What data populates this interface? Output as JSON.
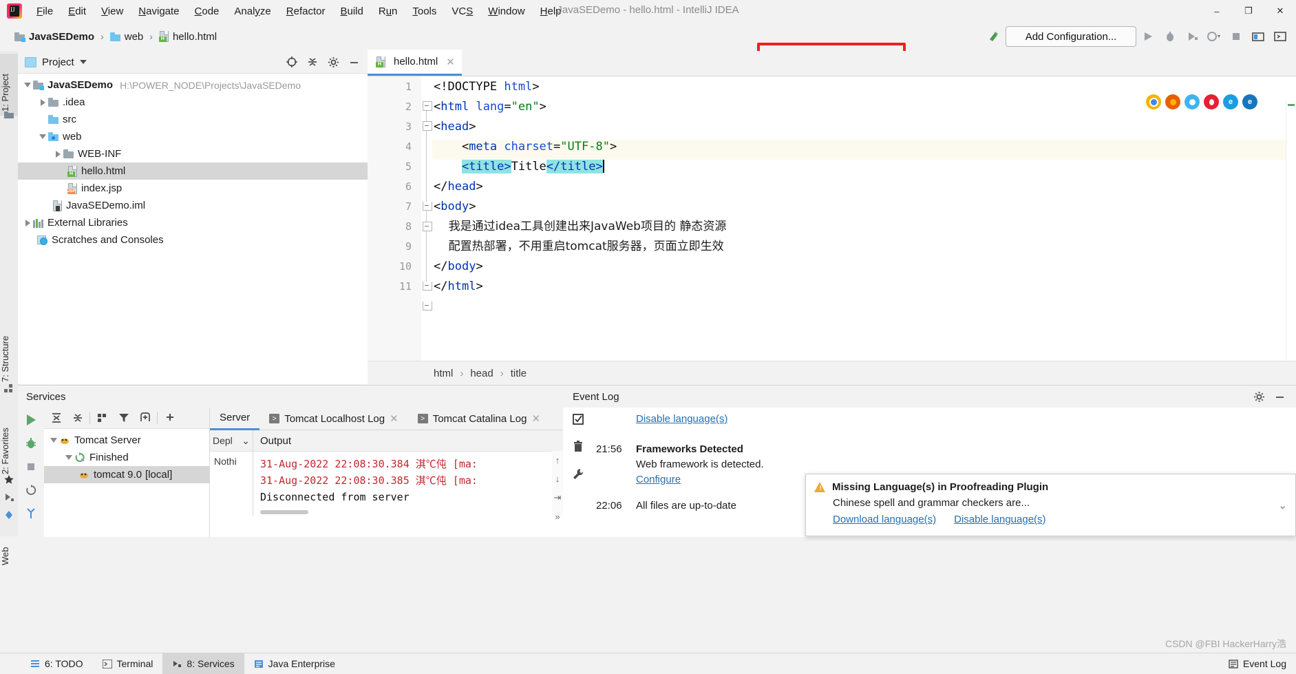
{
  "window": {
    "title": "JavaSEDemo - hello.html - IntelliJ IDEA",
    "minimize": "–",
    "maximize": "❐",
    "close": "✕"
  },
  "menubar": {
    "items": [
      {
        "label": "File",
        "mnemonic": "F"
      },
      {
        "label": "Edit",
        "mnemonic": "E"
      },
      {
        "label": "View",
        "mnemonic": "V"
      },
      {
        "label": "Navigate",
        "mnemonic": "N"
      },
      {
        "label": "Code",
        "mnemonic": "C"
      },
      {
        "label": "Analyze",
        "mnemonic": "y"
      },
      {
        "label": "Refactor",
        "mnemonic": "R"
      },
      {
        "label": "Build",
        "mnemonic": "B"
      },
      {
        "label": "Run",
        "mnemonic": "u"
      },
      {
        "label": "Tools",
        "mnemonic": "T"
      },
      {
        "label": "VCS",
        "mnemonic": "S"
      },
      {
        "label": "Window",
        "mnemonic": "W"
      },
      {
        "label": "Help",
        "mnemonic": "H"
      }
    ]
  },
  "navbar": {
    "breadcrumbs": [
      {
        "label": "JavaSEDemo",
        "icon": "module-icon"
      },
      {
        "label": "web",
        "icon": "folder-icon"
      },
      {
        "label": "hello.html",
        "icon": "html-file-icon"
      }
    ],
    "separator": "›",
    "add_configuration_label": "Add Configuration...",
    "highlight_color": "#f21f1f",
    "toolbar_icons": [
      "build-icon",
      "run-icon",
      "debug-icon",
      "run-coverage-icon",
      "profiler-icon",
      "stop-icon",
      "settings-sync-icon",
      "search-everywhere-icon"
    ]
  },
  "left_rail": {
    "top": [
      {
        "label": "1: Project",
        "selected": true
      }
    ],
    "bottom": [
      {
        "label": "7: Structure"
      },
      {
        "label": "2: Favorites"
      },
      {
        "label": "Web"
      }
    ]
  },
  "project_panel": {
    "title": "Project",
    "icons": [
      "locate-icon",
      "collapse-all-icon",
      "gear-icon",
      "hide-icon"
    ],
    "tree": [
      {
        "label": "JavaSEDemo",
        "path": "H:\\POWER_NODE\\Projects\\JavaSEDemo",
        "depth": 0,
        "state": "expanded",
        "icon": "module-icon",
        "bold": true
      },
      {
        "label": ".idea",
        "depth": 1,
        "state": "collapsed",
        "icon": "folder-icon"
      },
      {
        "label": "src",
        "depth": 1,
        "state": "leaf",
        "icon": "source-folder-icon"
      },
      {
        "label": "web",
        "depth": 1,
        "state": "expanded",
        "icon": "web-folder-icon"
      },
      {
        "label": "WEB-INF",
        "depth": 2,
        "state": "collapsed",
        "icon": "folder-icon"
      },
      {
        "label": "hello.html",
        "depth": 2,
        "state": "leaf",
        "icon": "html-file-icon",
        "selected": true
      },
      {
        "label": "index.jsp",
        "depth": 2,
        "state": "leaf",
        "icon": "jsp-file-icon"
      },
      {
        "label": "JavaSEDemo.iml",
        "depth": 1,
        "state": "leaf",
        "icon": "iml-file-icon"
      },
      {
        "label": "External Libraries",
        "depth": 0,
        "state": "collapsed",
        "icon": "libraries-icon"
      },
      {
        "label": "Scratches and Consoles",
        "depth": 0,
        "state": "leaf",
        "icon": "scratches-icon"
      }
    ]
  },
  "editor": {
    "tab": {
      "label": "hello.html",
      "icon": "html-file-icon",
      "close": "✕"
    },
    "browser_icons": [
      "chrome-icon",
      "firefox-icon",
      "safari-icon",
      "opera-icon",
      "edge-icon",
      "edge-legacy-icon"
    ],
    "lines": [
      {
        "n": 1,
        "segments": [
          {
            "t": "<!DOCTYPE ",
            "c": "punct"
          },
          {
            "t": "html",
            "c": "attr"
          },
          {
            "t": ">",
            "c": "punct"
          }
        ]
      },
      {
        "n": 2,
        "segments": [
          {
            "t": "<",
            "c": "punct"
          },
          {
            "t": "html",
            "c": "tag"
          },
          {
            "t": " ",
            "c": "punct"
          },
          {
            "t": "lang",
            "c": "attr"
          },
          {
            "t": "=",
            "c": "punct"
          },
          {
            "t": "\"en\"",
            "c": "val"
          },
          {
            "t": ">",
            "c": "punct"
          }
        ],
        "fold": "start"
      },
      {
        "n": 3,
        "segments": [
          {
            "t": "<",
            "c": "punct"
          },
          {
            "t": "head",
            "c": "tag"
          },
          {
            "t": ">",
            "c": "punct"
          }
        ],
        "fold": "start"
      },
      {
        "n": 4,
        "segments": [
          {
            "t": "    <",
            "c": "punct"
          },
          {
            "t": "meta ",
            "c": "tag"
          },
          {
            "t": "charset",
            "c": "attr"
          },
          {
            "t": "=",
            "c": "punct"
          },
          {
            "t": "\"UTF-8\"",
            "c": "val"
          },
          {
            "t": ">",
            "c": "punct"
          }
        ]
      },
      {
        "n": 5,
        "highlighted": true,
        "segments": [
          {
            "t": "    ",
            "c": "punct"
          },
          {
            "t": "<title>",
            "c": "tag",
            "hl": true
          },
          {
            "t": "Title",
            "c": "txt"
          },
          {
            "t": "</title>",
            "c": "tag",
            "hl": true
          }
        ],
        "caret": true
      },
      {
        "n": 6,
        "segments": [
          {
            "t": "</",
            "c": "punct"
          },
          {
            "t": "head",
            "c": "tag"
          },
          {
            "t": ">",
            "c": "punct"
          }
        ],
        "fold": "end"
      },
      {
        "n": 7,
        "segments": [
          {
            "t": "<",
            "c": "punct"
          },
          {
            "t": "body",
            "c": "tag"
          },
          {
            "t": ">",
            "c": "punct"
          }
        ],
        "fold": "start"
      },
      {
        "n": 8,
        "segments": [
          {
            "t": "    我是通过idea工具创建出来JavaWeb项目的 静态资源",
            "c": "txt",
            "cn": true
          }
        ]
      },
      {
        "n": 9,
        "segments": [
          {
            "t": "    配置热部署，不用重启tomcat服务器，页面立即生效",
            "c": "txt",
            "cn": true
          }
        ]
      },
      {
        "n": 10,
        "segments": [
          {
            "t": "</",
            "c": "punct"
          },
          {
            "t": "body",
            "c": "tag"
          },
          {
            "t": ">",
            "c": "punct"
          }
        ],
        "fold": "end"
      },
      {
        "n": 11,
        "segments": [
          {
            "t": "</",
            "c": "punct"
          },
          {
            "t": "html",
            "c": "tag"
          },
          {
            "t": ">",
            "c": "punct"
          }
        ],
        "fold": "end"
      }
    ],
    "breadcrumbs": [
      "html",
      "head",
      "title"
    ],
    "breadcrumb_separator": "›"
  },
  "services": {
    "title": "Services",
    "toolbar_icons": [
      "run-icon",
      "debug-icon",
      "stop-icon",
      "rerun-icon",
      "settings-icon"
    ],
    "tree_toolbar_icons": [
      "expand-all-icon",
      "collapse-all-icon",
      "group-icon",
      "filter-icon",
      "add-frame-icon",
      "add-icon"
    ],
    "tree": [
      {
        "label": "Tomcat Server",
        "depth": 0,
        "state": "expanded",
        "icon": "tomcat-icon"
      },
      {
        "label": "Finished",
        "depth": 1,
        "state": "expanded",
        "icon": "finished-icon"
      },
      {
        "label": "tomcat 9.0",
        "suffix": "[local]",
        "depth": 2,
        "state": "leaf",
        "icon": "tomcat-icon",
        "selected": true
      }
    ],
    "tabs": [
      {
        "label": "Server",
        "active": true,
        "icon": null,
        "closable": false
      },
      {
        "label": "Tomcat Localhost Log",
        "active": false,
        "icon": "console-icon",
        "closable": true
      },
      {
        "label": "Tomcat Catalina Log",
        "active": false,
        "icon": "console-icon",
        "closable": true
      }
    ],
    "columns": {
      "deploy": "Depl",
      "output": "Output"
    },
    "deploy_empty": "Nothi",
    "output_lines": [
      {
        "text": "31-Aug-2022 22:08:30.384 淇℃伅 [ma:",
        "color": "#c1282b"
      },
      {
        "text": "31-Aug-2022 22:08:30.385 淇℃伅 [ma:",
        "color": "#c1282b"
      },
      {
        "text": "Disconnected from server",
        "color": "#111111"
      }
    ],
    "side_icons": [
      "up-icon",
      "down-icon",
      "soft-wrap-icon",
      "more-icon"
    ]
  },
  "event_log": {
    "title": "Event Log",
    "header_icons": [
      "gear-icon",
      "hide-icon"
    ],
    "tool_icons": [
      "mark-read-icon",
      "delete-icon",
      "settings-wrench-icon"
    ],
    "entries": [
      {
        "time": "",
        "link": "Disable language(s)",
        "type": "link"
      },
      {
        "time": "21:56",
        "title": "Frameworks Detected",
        "body": "Web framework is detected.",
        "link": "Configure",
        "type": "full"
      },
      {
        "time": "22:06",
        "title": "All files are up-to-date",
        "type": "plain"
      }
    ]
  },
  "popup": {
    "title": "Missing Language(s) in Proofreading Plugin",
    "body": "Chinese spell and grammar checkers are...",
    "links": [
      "Download language(s)",
      "Disable language(s)"
    ],
    "collapse_icon": "chevron-down-icon",
    "warn_icon": "warning-icon"
  },
  "statusbar": {
    "items": [
      {
        "label": "6: TODO",
        "icon": "todo-icon"
      },
      {
        "label": "Terminal",
        "icon": "terminal-icon"
      },
      {
        "label": "8: Services",
        "icon": "services-icon",
        "active": true
      },
      {
        "label": "Java Enterprise",
        "icon": "java-ee-icon"
      }
    ],
    "right_items": [
      {
        "label": "Event Log",
        "icon": "event-log-icon"
      }
    ]
  },
  "watermark": "CSDN @FBI HackerHarry浩"
}
